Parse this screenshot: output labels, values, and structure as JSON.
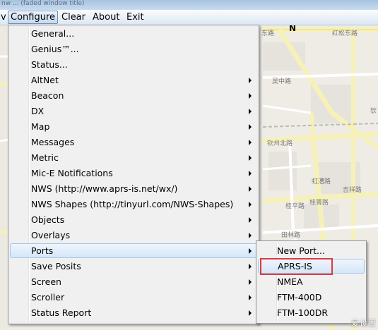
{
  "title_strip": {
    "fragment": "nw  ... (faded window title)"
  },
  "menubar": {
    "items": [
      {
        "label": "v"
      },
      {
        "label": "Configure"
      },
      {
        "label": "Clear"
      },
      {
        "label": "About"
      },
      {
        "label": "Exit"
      }
    ]
  },
  "configure_menu": {
    "items": [
      {
        "label": "General...",
        "submenu": false
      },
      {
        "label": "Genius™...",
        "submenu": false
      },
      {
        "label": "Status...",
        "submenu": false
      },
      {
        "label": "AltNet",
        "submenu": true
      },
      {
        "label": "Beacon",
        "submenu": true
      },
      {
        "label": "DX",
        "submenu": true
      },
      {
        "label": "Map",
        "submenu": true
      },
      {
        "label": "Messages",
        "submenu": true
      },
      {
        "label": "Metric",
        "submenu": true
      },
      {
        "label": "Mic-E Notifications",
        "submenu": true
      },
      {
        "label": "NWS (http://www.aprs-is.net/wx/)",
        "submenu": true
      },
      {
        "label": "NWS Shapes (http://tinyurl.com/NWS-Shapes)",
        "submenu": true
      },
      {
        "label": "Objects",
        "submenu": true
      },
      {
        "label": "Overlays",
        "submenu": true
      },
      {
        "label": "Ports",
        "submenu": true,
        "hover": true
      },
      {
        "label": "Save Posits",
        "submenu": true
      },
      {
        "label": "Screen",
        "submenu": true
      },
      {
        "label": "Scroller",
        "submenu": true
      },
      {
        "label": "Status Report",
        "submenu": true
      }
    ]
  },
  "ports_submenu": {
    "items": [
      {
        "label": "New Port..."
      },
      {
        "label": "APRS-IS",
        "hover": true,
        "highlighted": true
      },
      {
        "label": "NMEA"
      },
      {
        "label": "FTM-400D"
      },
      {
        "label": "FTM-100DR"
      }
    ]
  },
  "map": {
    "north_label": "N",
    "street_labels": [
      "东路",
      "红松东路",
      "吴中路",
      "钦州北路",
      "虹漕路",
      "桂平路",
      "桂箐路",
      "吉祥路",
      "田林路",
      "钦"
    ]
  },
  "watermark": "爱设置",
  "colors": {
    "menu_bg": "#f0f0f0",
    "hover_bg": "#d6e6f8",
    "highlight_border": "#e0383e",
    "map_bg": "#efece6"
  }
}
